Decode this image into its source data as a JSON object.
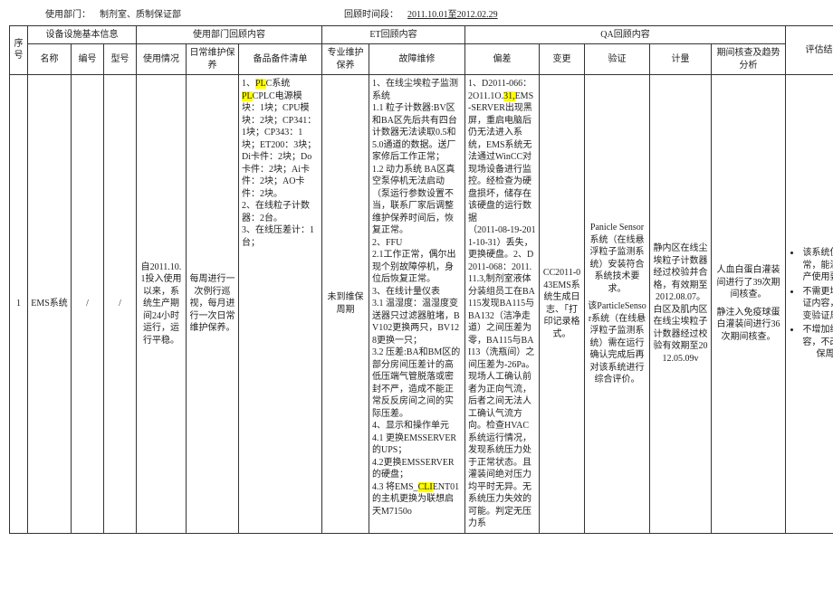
{
  "header": {
    "dept_label": "使用部门：",
    "dept_value": "制剂室、质制保证部",
    "period_label": "回顾时间段：",
    "period_value": "2011.10.01至2012.02.29"
  },
  "columns": {
    "seq": "序号",
    "basic_group": "设备设施基本信息",
    "name": "名称",
    "code": "编号",
    "model": "型号",
    "user_group": "使用部门回顾内容",
    "usage": "使用情况",
    "daily": "日常维护保养",
    "spare": "备品备件清单",
    "et_group": "ET回顾内容",
    "prof": "专业维护保养",
    "fault": "故障维修",
    "qa_group": "QA回顾内容",
    "dev": "偏差",
    "change": "变更",
    "verify": "验证",
    "metro": "计量",
    "period": "期间核查及趋势分析",
    "conclusion": "评估结论"
  },
  "row": {
    "seq": "1",
    "name": "EMS系统",
    "code": "/",
    "model": "/",
    "usage": "自2011.10.1投入使用以来，系统生产期间24小时运行，运行平稳。",
    "daily": "每周进行一次例行巡视，每月进行一次日常维护保养。",
    "spare_parts": [
      "1、PLC系统",
      "PLC电源模块：1块；CPU模块：2块；CP341：1块；CP343：1块；ET200：3块；Di卡件：2块；Do卡件：2块；Ai卡件：2块；AO卡件：2块。",
      "2、在线粒子计数器：2台。",
      "3、在线压差计：1台；"
    ],
    "spare_hl": {
      "a": "PL",
      "b": "C"
    },
    "prof": "未到维保周期",
    "fault": [
      "1、在线尘埃粒子监测系统",
      "1.1 粒子计数器:BV区和BA区先后共有四台计数器无法读取0.5和5.0通道的数据。送厂家修后工作正常；",
      "1.2 动力系统 BA区真空泵停机无法启动（泵运行参数设置不当，联系厂家后调整维护保养时间后，恢复正常。",
      "2、FFU",
      "2.1工作正常，偶尔出现个别故障停机，身位后恢复正常。",
      "3、在线计量仪表",
      "3.1 温湿度：温湿度变送器只过滤器脏堵，BV102更换两只，BV128更换一只；",
      "3.2 压差:BA和BM区的部分房间压差计的高低压端气管脱落或密封不严，造成不能正常反反房间之间的实际压差。",
      "4、显示和操作单元",
      "4.1 更换EMSSERVER的UPS；",
      "4.2更换EMSSERVER的硬盘；",
      "4.3 将EMS_CLIENT01的主机更换为联想启天M7150o"
    ],
    "fault_hl": {
      "a": "CL",
      "b": "I"
    },
    "dev": [
      "1、D2011-066：",
      "2O11.1O.31,EMS-SERVER出现黑屏，重启电脑后仍无法进入系统，EMS系统无法通过WinCC对现场设备进行监控。经检查为硬盘损坏，储存在该硬盘的运行数据",
      "（2011-08-19-2011-10-31）丢失，更换硬盘。2、D2011-068：2011.11.3,制剂室液体分装组员工在BA115发现BA115与BA132（洁净走道）之间压差为零，BA115与BAI13（洗瓶间）之间压差为-26Pa。现场人工确认前者为正向气流，后者之间无法人工确认气流方向。检查HVAC系统运行情况，发现系统压力处于正常状态。且灌装间绝对压力均平时无异。无系统压力失效的可能。判定无压力系"
    ],
    "dev_hl": {
      "a": "31,"
    },
    "change": "CC2011-043EMS系统生成日志、「打印记录格式。",
    "verify": [
      "Panicle Sensor系统（在线悬浮粒子监测系统）安装符合系统技术要求。",
      "该ParticleSensor系统（在线悬浮粒子监测系统）需在运行确认完成后再对该系统进行综合评价。"
    ],
    "metro": "静内区在线尘埃粒子计数器经过校验并合格，有效期至2012.08.07。白区及肌内区在线尘埃粒子计数器经过校验有效期至2012.05.09v",
    "period": [
      "人血白蛋白灌装间进行了39次期间核查。",
      "静注入免疫球蛋白灌装间进行36次期间核查。"
    ],
    "conclusion": [
      "该系统使用正常，能满足生产使用要求。",
      "不需更增加验证内容，不改变验证周期。",
      "不增加维保内容，不改变维保周期"
    ]
  }
}
